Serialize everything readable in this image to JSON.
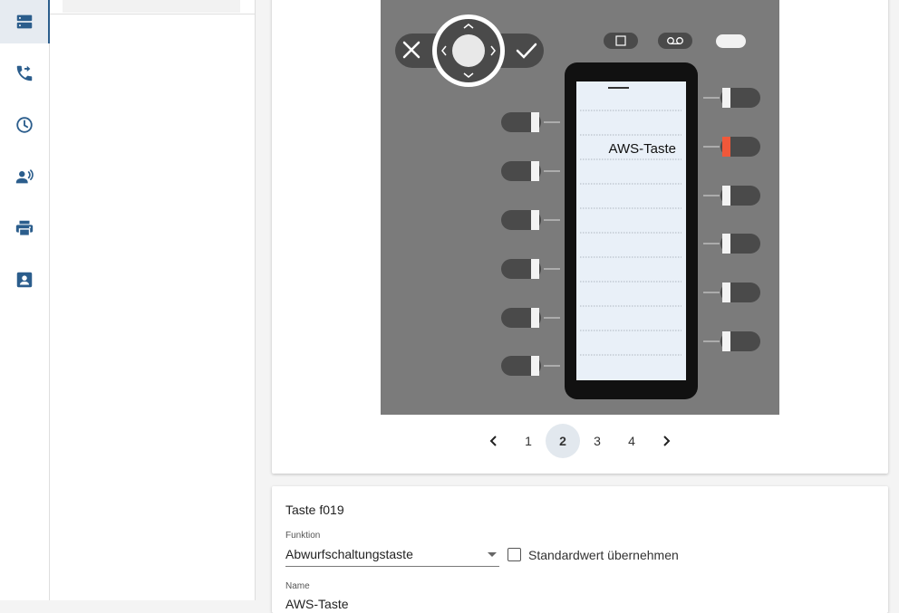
{
  "rail": {
    "items": [
      {
        "name": "server-icon",
        "active": true
      },
      {
        "name": "call-forward-icon",
        "active": false
      },
      {
        "name": "clock-icon",
        "active": false
      },
      {
        "name": "voice-user-icon",
        "active": false
      },
      {
        "name": "printer-icon",
        "active": false
      },
      {
        "name": "contact-card-icon",
        "active": false
      }
    ]
  },
  "phone": {
    "highlighted_key_label": "AWS-Taste",
    "colors": {
      "body": "#7b7b7b",
      "screen": "#e9f0f8",
      "key": "#4a4a4a",
      "highlight": "#f0583a"
    }
  },
  "pagination": {
    "pages": [
      "1",
      "2",
      "3",
      "4"
    ],
    "current": "2"
  },
  "key_form": {
    "title": "Taste f019",
    "function_label": "Funktion",
    "function_value": "Abwurfschaltungstaste",
    "default_checkbox_label": "Standardwert übernehmen",
    "name_label": "Name",
    "name_value": "AWS-Taste"
  }
}
